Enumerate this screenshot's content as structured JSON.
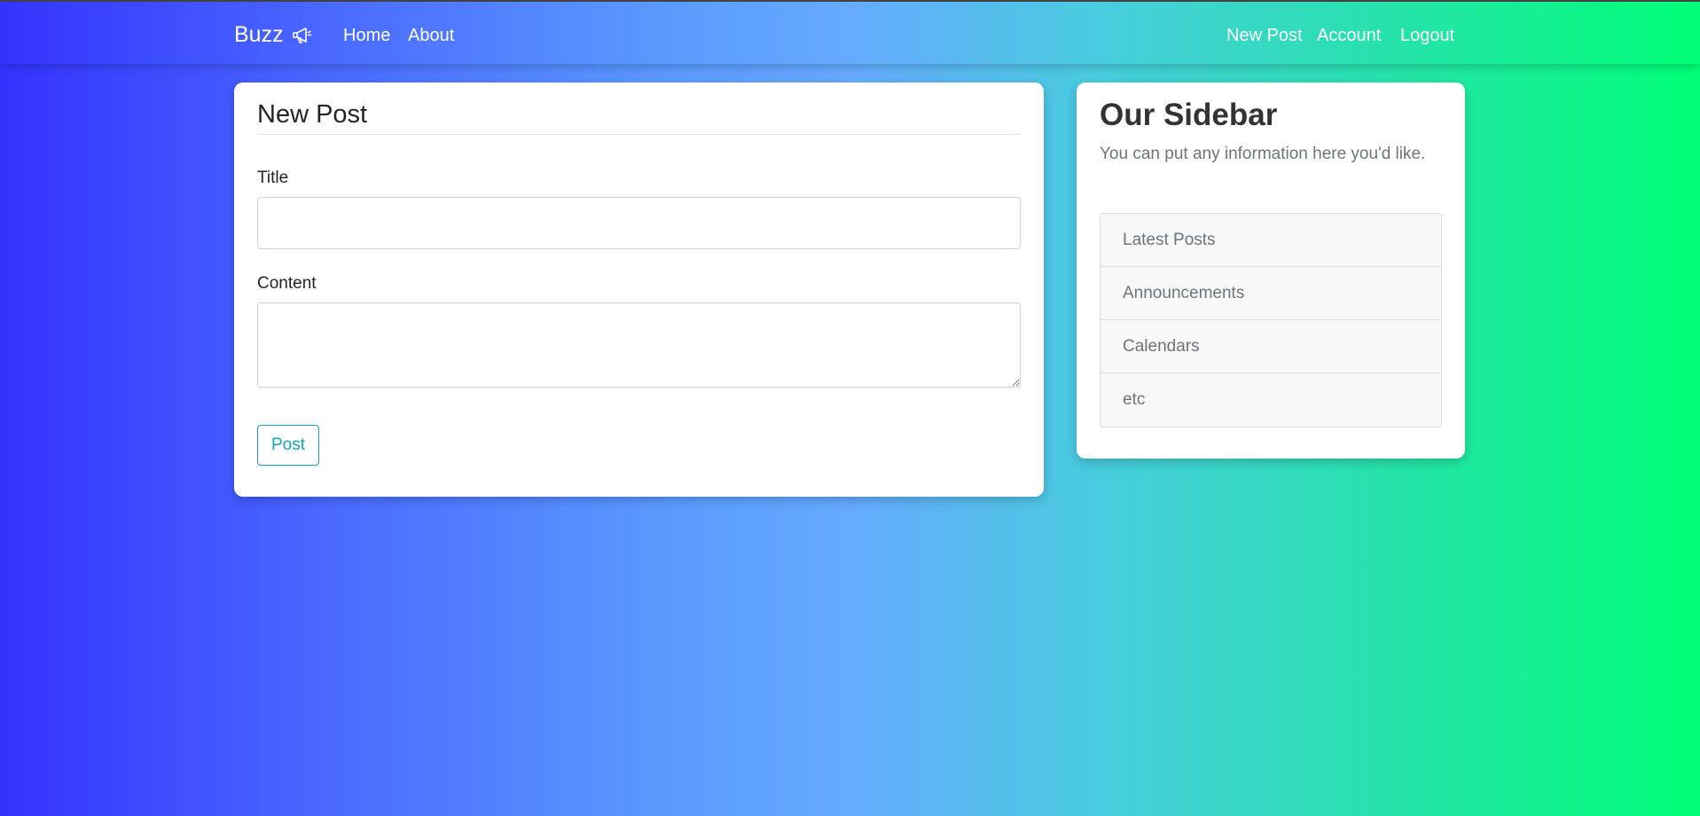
{
  "navbar": {
    "brand": "Buzz",
    "brand_icon": "megaphone-icon",
    "left_links": [
      "Home",
      "About"
    ],
    "right_links": [
      "New Post",
      "Account",
      "Logout"
    ]
  },
  "post_form": {
    "heading": "New Post",
    "title_label": "Title",
    "title_value": "",
    "content_label": "Content",
    "content_value": "",
    "submit_label": "Post"
  },
  "sidebar": {
    "title": "Our Sidebar",
    "text": "You can put any information here you'd like.",
    "items": [
      "Latest Posts",
      "Announcements",
      "Calendars",
      "etc"
    ]
  },
  "colors": {
    "gradient_start": "#3333ff",
    "gradient_middle": "#66aaff",
    "gradient_end": "#00ff77",
    "button_accent": "#17a2b8"
  }
}
